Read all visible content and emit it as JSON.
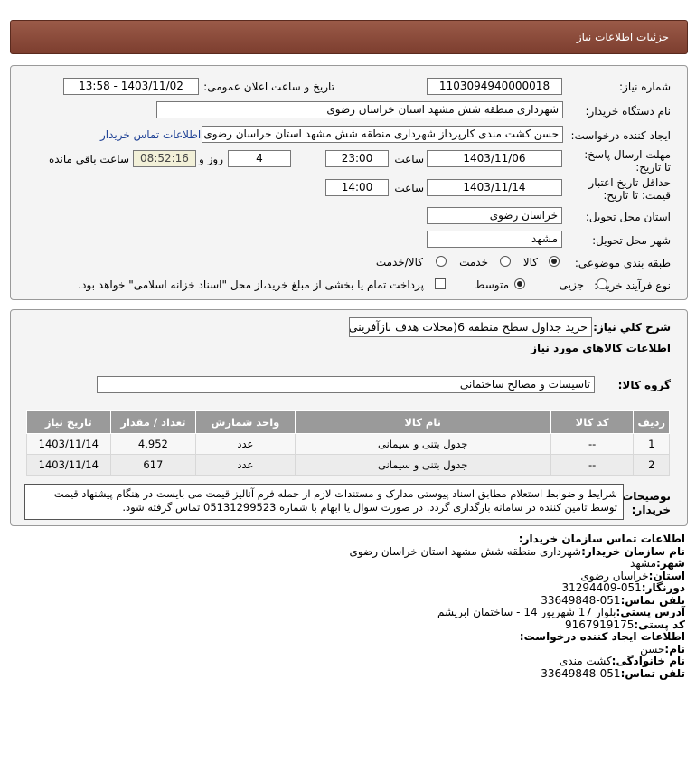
{
  "page_title": "جزئیات اطلاعات نیاز",
  "fields": {
    "need_number_label": "شماره نیاز:",
    "need_number": "1103094940000018",
    "announce_label": "تاریخ و ساعت اعلان عمومی:",
    "announce_value": "1403/11/02 - 13:58",
    "buyer_label": "نام دستگاه خریدار:",
    "buyer_value": "شهرداری منطقه شش مشهد استان خراسان رضوی",
    "creator_label": "ایجاد کننده درخواست:",
    "creator_value": "حسن کشت مندی کارپرداز شهرداری منطقه شش مشهد استان خراسان رضوی",
    "contact_link": "اطلاعات تماس خریدار",
    "deadline_label": "مهلت ارسال پاسخ: تا تاریخ:",
    "deadline_date": "1403/11/06",
    "time_label": "ساعت",
    "deadline_time": "23:00",
    "days_value": "4",
    "days_label": "روز و",
    "remaining_timer": "08:52:16",
    "remaining_label": "ساعت باقی مانده",
    "validity_label": "حداقل تاریخ اعتبار قیمت: تا تاریخ:",
    "validity_date": "1403/11/14",
    "validity_time": "14:00",
    "province_label": "استان محل تحویل:",
    "province_value": "خراسان رضوی",
    "city_label": "شهر محل تحویل:",
    "city_value": "مشهد",
    "category_label": "طبقه بندی موضوعی:",
    "category_options": [
      "کالا",
      "خدمت",
      "کالا/خدمت"
    ],
    "process_label": "نوع فرآیند خرید :",
    "process_options": [
      "جزیی",
      "متوسط"
    ],
    "payment_note": "پرداخت تمام یا بخشی از مبلغ خرید،از محل \"اسناد خزانه اسلامی\" خواهد بود."
  },
  "summary": {
    "label": "شرح کلي نياز:",
    "value": "خرید جداول سطح منطقه 6(محلات هدف بازآفرینی)",
    "goods_header": "اطلاعات کالاهای مورد نیاز",
    "group_label": "گروه کالا:",
    "group_value": "تاسیسات و مصالح ساختمانی"
  },
  "table": {
    "headers": [
      "ردیف",
      "کد کالا",
      "نام کالا",
      "واحد شمارش",
      "تعداد / مقدار",
      "تاریخ نیاز"
    ],
    "rows": [
      [
        "1",
        "--",
        "جدول بتنی و سیمانی",
        "عدد",
        "4,952",
        "1403/11/14"
      ],
      [
        "2",
        "--",
        "جدول بتنی و سیمانی",
        "عدد",
        "617",
        "1403/11/14"
      ]
    ]
  },
  "notes": {
    "label": "توضیحات خریدار:",
    "text": "شرایط و ضوابط استعلام مطابق اسناد پیوستی مدارک و مستندات لازم از جمله فرم آنالیز قیمت می بایست در هنگام پیشنهاد قیمت توسط تامین کننده در سامانه بارگذاری گردد. در صورت سوال یا ابهام با شماره 05131299523 تماس گرفته شود."
  },
  "buyer_contact": {
    "header": "اطلاعات تماس سازمان خریدار:",
    "org_label": "نام سازمان خریدار:",
    "org_value": "شهرداری منطقه شش مشهد استان خراسان رضوی",
    "city_label": "شهر:",
    "city_value": "مشهد",
    "province_label": "استان:",
    "province_value": "خراسان رضوی",
    "fax_label": "دورنگار:",
    "fax_value": "051-31294409",
    "phone_label": "تلفن تماس:",
    "phone_value": "051-33649848",
    "address_label": "آدرس پستی:",
    "address_value": "بلوار 17 شهریور 14 - ساختمان ابریشم",
    "postal_label": "کد پستی:",
    "postal_value": "9167919175"
  },
  "creator_contact": {
    "header": "اطلاعات ایجاد کننده درخواست:",
    "name_label": "نام:",
    "name_value": "حسن",
    "family_label": "نام خانوادگی:",
    "family_value": "کشت مندی",
    "phone_label": "تلفن تماس:",
    "phone_value": "051-33649848"
  },
  "colors": {
    "title_bar": "#8b4a3a",
    "link": "#1c3f94",
    "table_header": "#9a9a9a"
  }
}
